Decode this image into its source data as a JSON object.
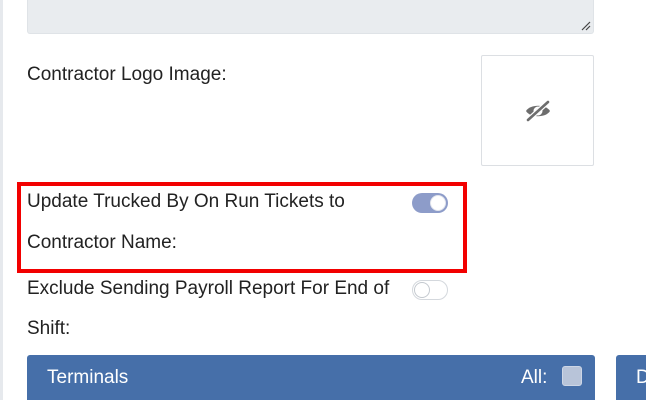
{
  "form": {
    "logo_label": "Contractor Logo Image:",
    "logo_placeholder_icon": "eye-slash-icon",
    "update_trucked_by_label_line1": "Update Trucked By On Run Tickets to",
    "update_trucked_by_label_line2": "Contractor Name:",
    "update_trucked_by_enabled": true,
    "exclude_payroll_label_line1": "Exclude Sending Payroll Report For End of",
    "exclude_payroll_label_line2": "Shift:",
    "exclude_payroll_enabled": false
  },
  "panels": [
    {
      "title": "Terminals",
      "all_label": "All:",
      "all_checked": false
    },
    {
      "title": "D"
    }
  ],
  "colors": {
    "highlight": "#f20000",
    "toggle_on": "#8d9cc9",
    "panel_header": "#466fa9"
  }
}
